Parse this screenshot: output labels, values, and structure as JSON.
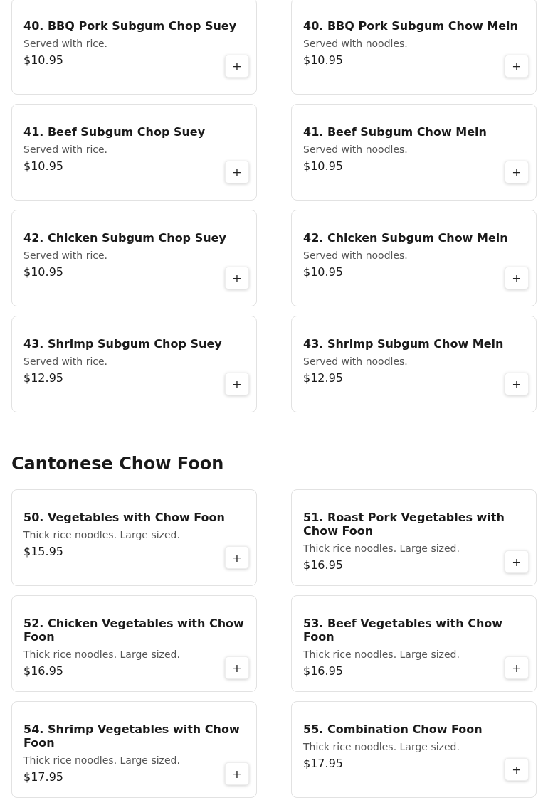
{
  "sections": [
    {
      "items": [
        {
          "name": "40. BBQ Pork Subgum Chop Suey",
          "description": "Served with rice.",
          "price": "$10.95",
          "button": "+"
        },
        {
          "name": "40. BBQ Pork Subgum Chow Mein",
          "description": "Served with noodles.",
          "price": "$10.95",
          "button": "+"
        },
        {
          "name": "41. Beef Subgum Chop Suey",
          "description": "Served with rice.",
          "price": "$10.95",
          "button": "+"
        },
        {
          "name": "41. Beef Subgum Chow Mein",
          "description": "Served with noodles.",
          "price": "$10.95",
          "button": "+"
        },
        {
          "name": "42. Chicken Subgum Chop Suey",
          "description": "Served with rice.",
          "price": "$10.95",
          "button": "+"
        },
        {
          "name": "42. Chicken Subgum Chow Mein",
          "description": "Served with noodles.",
          "price": "$10.95",
          "button": "+"
        },
        {
          "name": "43. Shrimp Subgum Chop Suey",
          "description": "Served with rice.",
          "price": "$12.95",
          "button": "+"
        },
        {
          "name": "43. Shrimp Subgum Chow Mein",
          "description": "Served with noodles.",
          "price": "$12.95",
          "button": "+"
        }
      ]
    },
    {
      "title": "Cantonese Chow Foon",
      "items": [
        {
          "name": "50. Vegetables with Chow Foon",
          "description": "Thick rice noodles. Large sized.",
          "price": "$15.95",
          "button": "+"
        },
        {
          "name": "51. Roast Pork Vegetables with Chow Foon",
          "description": "Thick rice noodles. Large sized.",
          "price": "$16.95",
          "button": "+"
        },
        {
          "name": "52. Chicken Vegetables with Chow Foon",
          "description": "Thick rice noodles. Large sized.",
          "price": "$16.95",
          "button": "+"
        },
        {
          "name": "53. Beef Vegetables with Chow Foon",
          "description": "Thick rice noodles. Large sized.",
          "price": "$16.95",
          "button": "+"
        },
        {
          "name": "54. Shrimp Vegetables with Chow Foon",
          "description": "Thick rice noodles. Large sized.",
          "price": "$17.95",
          "button": "+"
        },
        {
          "name": "55. Combination Chow Foon",
          "description": "Thick rice noodles. Large sized.",
          "price": "$17.95",
          "button": "+"
        }
      ]
    }
  ]
}
